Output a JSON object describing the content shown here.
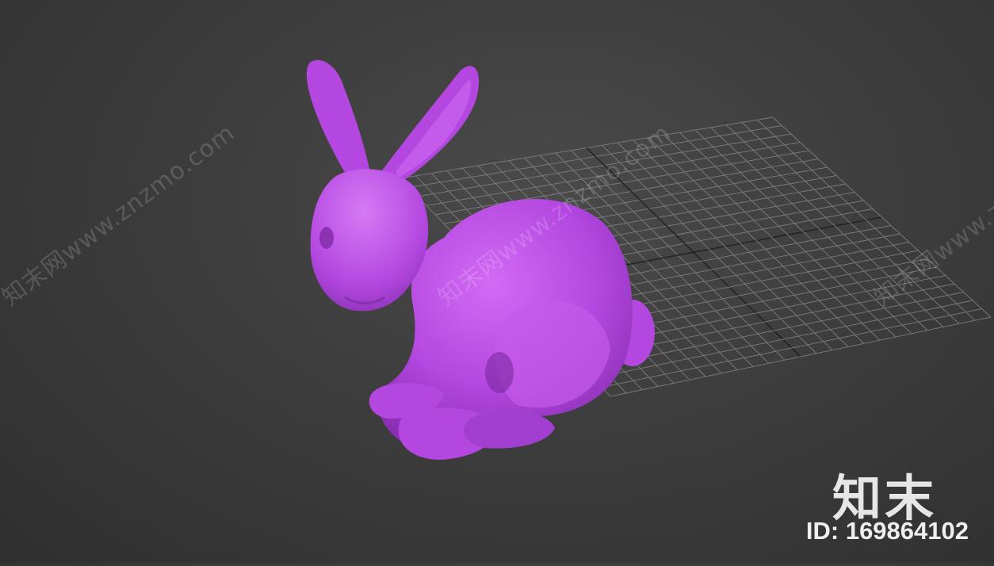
{
  "viewport": {
    "background": "#3d3d3d",
    "grid_color": "#8a8a8a",
    "grid_axis_color": "#1a1a1a",
    "model": "bunny",
    "model_color": "#b347e0"
  },
  "watermark": {
    "text": "知末网www.znzmo.com",
    "logo": "知末",
    "id_label": "ID: 169864102"
  }
}
